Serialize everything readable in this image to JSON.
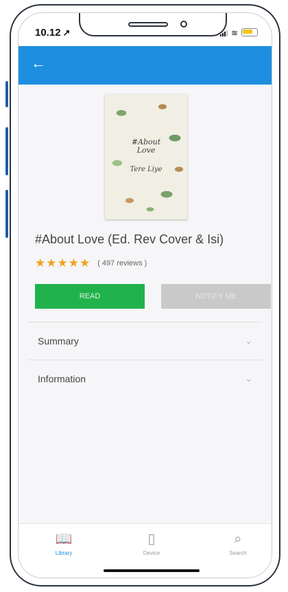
{
  "status_bar": {
    "time": "10.12",
    "nav_glyph": "↗"
  },
  "app_bar": {
    "back_icon": "←"
  },
  "book": {
    "cover_title": "#About Love",
    "cover_author": "Tere Liye",
    "title": "#About Love (Ed. Rev Cover & Isi)",
    "stars": "★★★★★",
    "reviews": "( 497 reviews )"
  },
  "actions": {
    "read_label": "READ",
    "notify_label": "NOTIFY ME"
  },
  "sections": [
    {
      "label": "Summary",
      "chevron": "⌄"
    },
    {
      "label": "Information",
      "chevron": "⌄"
    }
  ],
  "tabs": [
    {
      "label": "Library",
      "icon": "📖"
    },
    {
      "label": "Device",
      "icon": "▯"
    },
    {
      "label": "Search",
      "icon": "⌕"
    }
  ],
  "colors": {
    "accent": "#1e8fe0",
    "read": "#22b24c",
    "star": "#f0a21b",
    "disabled": "#c9c9c9"
  }
}
